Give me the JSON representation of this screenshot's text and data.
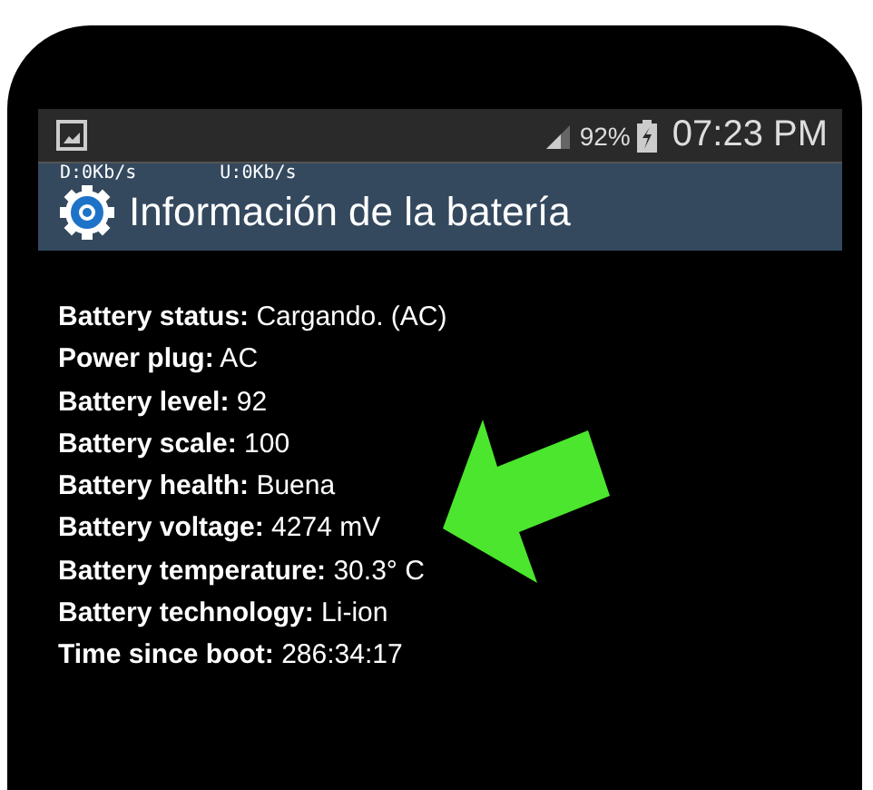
{
  "status_bar": {
    "battery": "92%",
    "time": "07:23 PM"
  },
  "title_bar": {
    "download": "D:0Kb/s",
    "upload": "U:0Kb/s",
    "title": "Información de la batería"
  },
  "info_lines": [
    "**Battery status:** Cargando. (AC)",
    "**Power plug:** AC",
    "**Battery level:** 92",
    "**Battery scale:** 100",
    "**Battery health:** Buena",
    "**Battery voltage:** 4274 mV",
    "**Battery temperature:** 30.3° C",
    "**Battery technology:** Li-ion",
    "**Time since boot:** 286:34:17"
  ]
}
